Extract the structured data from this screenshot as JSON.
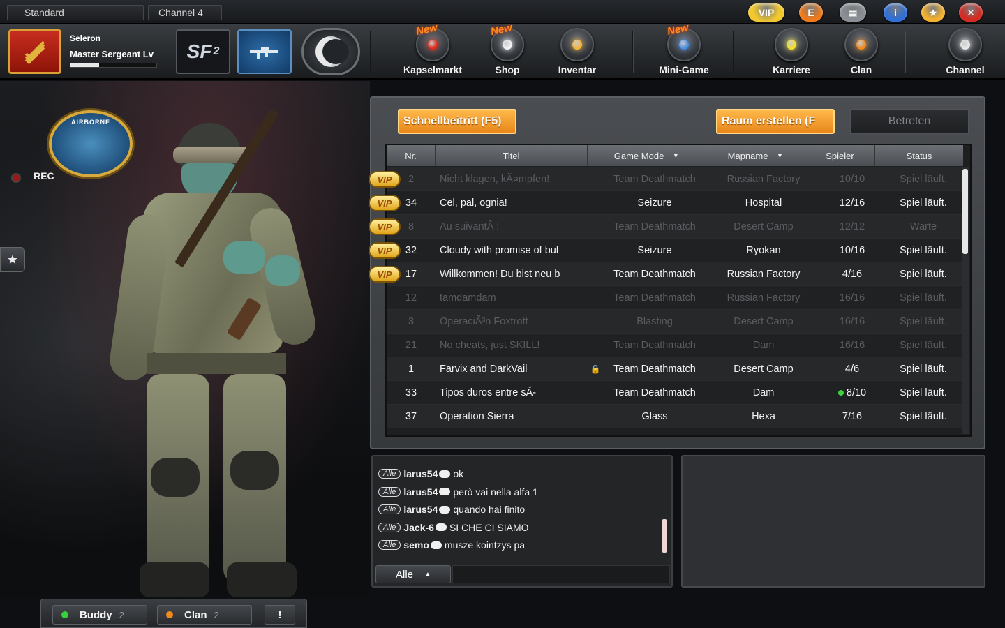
{
  "top": {
    "mode": "Standard",
    "channel": "Channel 4",
    "icons": [
      {
        "name": "vip-icon",
        "glyph": "VIP",
        "color": "#f2c82e"
      },
      {
        "name": "e-coin-icon",
        "glyph": "E",
        "color": "#f07a1a"
      },
      {
        "name": "film-icon",
        "glyph": "▦",
        "color": "#8a8f95"
      },
      {
        "name": "info-icon",
        "glyph": "i",
        "color": "#2f6fd6"
      },
      {
        "name": "star-coin-icon",
        "glyph": "★",
        "color": "#f2b12e"
      },
      {
        "name": "close-icon",
        "glyph": "✕",
        "color": "#d42a22"
      }
    ]
  },
  "player": {
    "name": "Seleron",
    "rank": "Master Sergeant Lv",
    "xp_fraction": 0.33
  },
  "nav": {
    "new_label": "New",
    "items": [
      {
        "label": "Kapselmarkt",
        "orb_color": "#e22a1a",
        "is_new": true
      },
      {
        "label": "Shop",
        "orb_color": "#f3f3f3",
        "is_new": true
      },
      {
        "label": "Inventar",
        "orb_color": "#f5b53a",
        "is_new": false
      },
      {
        "label": "Mini-Game",
        "orb_color": "#4a8ee0",
        "is_new": true
      },
      {
        "label": "Karriere",
        "orb_color": "#f3e02a",
        "is_new": false
      },
      {
        "label": "Clan",
        "orb_color": "#f08a1a",
        "is_new": false
      },
      {
        "label": "Channel",
        "orb_color": "#e8e8e8",
        "is_new": false
      }
    ]
  },
  "scene": {
    "badge_label": "AIRBORNE",
    "rec_label": "REC"
  },
  "room": {
    "quick_join": "Schnellbeitritt (F5)",
    "create_room": "Raum erstellen (F",
    "enter": "Betreten",
    "columns": {
      "nr": "Nr.",
      "title": "Titel",
      "mode": "Game Mode",
      "map": "Mapname",
      "players": "Spieler",
      "status": "Status"
    },
    "vip_label": "VIP",
    "rows": [
      {
        "nr": "2",
        "title": "Nicht klagen, kÃ¤mpfen!",
        "mode": "Team Deathmatch",
        "map": "Russian Factory",
        "players": "10/10",
        "status": "Spiel läuft.",
        "active": false,
        "vip": true,
        "lock": false,
        "dot": false
      },
      {
        "nr": "34",
        "title": "Cel, pal, ognia!",
        "mode": "Seizure",
        "map": "Hospital",
        "players": "12/16",
        "status": "Spiel läuft.",
        "active": true,
        "vip": true,
        "lock": false,
        "dot": false
      },
      {
        "nr": "8",
        "title": "Au suivantÂ !",
        "mode": "Team Deathmatch",
        "map": "Desert Camp",
        "players": "12/12",
        "status": "Warte",
        "active": false,
        "vip": true,
        "lock": false,
        "dot": false
      },
      {
        "nr": "32",
        "title": "Cloudy with promise of bul",
        "mode": "Seizure",
        "map": "Ryokan",
        "players": "10/16",
        "status": "Spiel läuft.",
        "active": true,
        "vip": true,
        "lock": false,
        "dot": false
      },
      {
        "nr": "17",
        "title": "Willkommen! Du bist neu b",
        "mode": "Team Deathmatch",
        "map": "Russian Factory",
        "players": "4/16",
        "status": "Spiel läuft.",
        "active": true,
        "vip": true,
        "lock": false,
        "dot": false
      },
      {
        "nr": "12",
        "title": "tamdamdam",
        "mode": "Team Deathmatch",
        "map": "Russian Factory",
        "players": "16/16",
        "status": "Spiel läuft.",
        "active": false,
        "vip": false,
        "lock": false,
        "dot": false
      },
      {
        "nr": "3",
        "title": "OperaciÃ³n Foxtrott",
        "mode": "Blasting",
        "map": "Desert Camp",
        "players": "16/16",
        "status": "Spiel läuft.",
        "active": false,
        "vip": false,
        "lock": false,
        "dot": false
      },
      {
        "nr": "21",
        "title": "No cheats, just SKILL!",
        "mode": "Team Deathmatch",
        "map": "Dam",
        "players": "16/16",
        "status": "Spiel läuft.",
        "active": false,
        "vip": false,
        "lock": false,
        "dot": false
      },
      {
        "nr": "1",
        "title": "Farvix and DarkVail",
        "mode": "Team Deathmatch",
        "map": "Desert Camp",
        "players": "4/6",
        "status": "Spiel läuft.",
        "active": true,
        "vip": false,
        "lock": true,
        "dot": false
      },
      {
        "nr": "33",
        "title": "Tipos duros entre sÃ-",
        "mode": "Team Deathmatch",
        "map": "Dam",
        "players": "8/10",
        "status": "Spiel läuft.",
        "active": true,
        "vip": false,
        "lock": false,
        "dot": true
      },
      {
        "nr": "37",
        "title": "Operation Sierra",
        "mode": "Glass",
        "map": "Hexa",
        "players": "7/16",
        "status": "Spiel läuft.",
        "active": true,
        "vip": false,
        "lock": false,
        "dot": false
      }
    ]
  },
  "chat": {
    "messages": [
      {
        "channel": "Alle",
        "user": "larus54",
        "text": "ok"
      },
      {
        "channel": "Alle",
        "user": "larus54",
        "text": "però vai nella alfa 1"
      },
      {
        "channel": "Alle",
        "user": "larus54",
        "text": "quando hai finito"
      },
      {
        "channel": "Alle",
        "user": "Jack-6",
        "text": "SI CHE CI SIAMO"
      },
      {
        "channel": "Alle",
        "user": "semo",
        "text": "musze kointzys pa"
      }
    ],
    "channel_select": "Alle"
  },
  "bottom": {
    "buddy_label": "Buddy",
    "buddy_count": "2",
    "clan_label": "Clan",
    "clan_count": "2",
    "alert_label": "!"
  }
}
